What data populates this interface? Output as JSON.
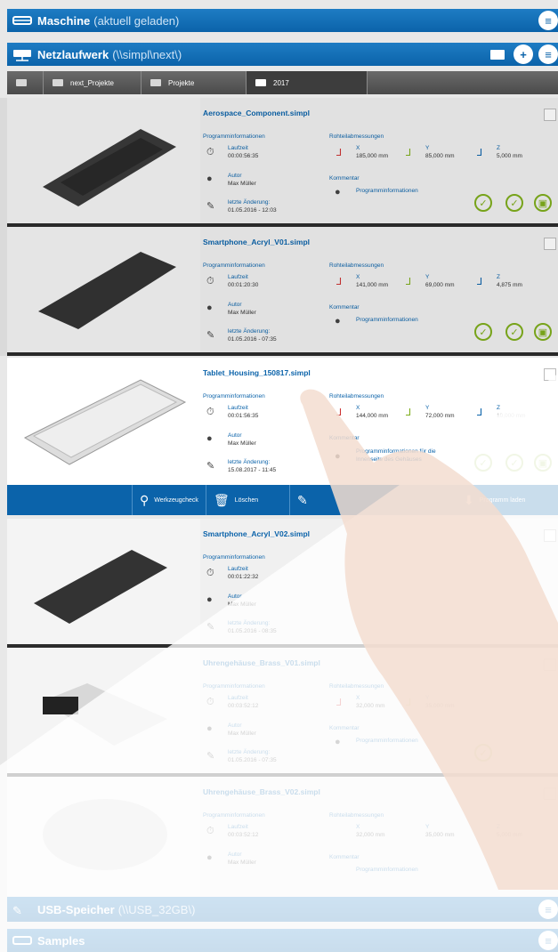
{
  "machine_bar": {
    "title": "Maschine",
    "subtitle": "(aktuell geladen)"
  },
  "network_bar": {
    "title": "Netzlaufwerk",
    "subtitle": "(\\\\simpl\\next\\)"
  },
  "breadcrumb": [
    "next_Projekte",
    "Projekte",
    "2017"
  ],
  "labels": {
    "programminfo": "Programminformationen",
    "raw": "Rohteilabmessungen",
    "runtime": "Laufzeit",
    "author": "Autor",
    "last_change": "letzte Änderung:",
    "comment": "Kommentar"
  },
  "files": [
    {
      "name": "Aerospace_Component.simpl",
      "runtime": "00:00:56:35",
      "author": "Max Müller",
      "changed": "01.05.2016 - 12:03",
      "x": "185,000 mm",
      "y": "85,000 mm",
      "z": "5,000 mm",
      "comment": "Programminformationen"
    },
    {
      "name": "Smartphone_Acryl_V01.simpl",
      "runtime": "00:01:20:30",
      "author": "Max Müller",
      "changed": "01.05.2016 - 07:35",
      "x": "141,000 mm",
      "y": "69,000 mm",
      "z": "4,875 mm",
      "comment": "Programminformationen"
    },
    {
      "name": "Tablet_Housing_150817.simpl",
      "runtime": "00:01:56:35",
      "author": "Max Müller",
      "changed": "15.08.2017 - 11:45",
      "x": "144,000 mm",
      "y": "72,000 mm",
      "z": "10,000 mm",
      "comment": "Programminformationen für die Innenseite des Gehäuses"
    },
    {
      "name": "Smartphone_Acryl_V02.simpl",
      "runtime": "00:01:22:32",
      "author": "Max Müller",
      "changed": "01.05.2016 - 08:35",
      "x": "",
      "y": "",
      "z": "",
      "comment": ""
    },
    {
      "name": "Uhrengehäuse_Brass_V01.simpl",
      "runtime": "00:03:52:12",
      "author": "Max Müller",
      "changed": "01.05.2016 - 07:35",
      "x": "32,000 mm",
      "y": "35,000 mm",
      "z": "",
      "comment": "Programminformationen"
    },
    {
      "name": "Uhrengehäuse_Brass_V02.simpl",
      "runtime": "00:03:52:12",
      "author": "Max Müller",
      "changed": "",
      "x": "32,000 mm",
      "y": "35,000 mm",
      "z": "5,000 mm",
      "comment": "Programminformationen"
    }
  ],
  "toolbar": {
    "toolcheck": "Werkzeugcheck",
    "delete": "Löschen",
    "load": "Programm laden"
  },
  "usb_bar": {
    "title": "USB-Speicher",
    "subtitle": "(\\\\USB_32GB\\)"
  },
  "samples_bar": {
    "title": "Samples"
  }
}
